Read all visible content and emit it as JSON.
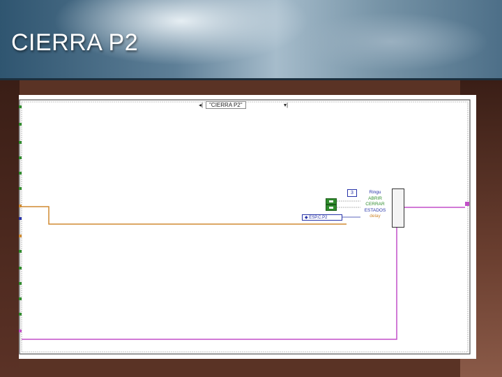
{
  "slide": {
    "title": "CIERRA P2"
  },
  "diagram": {
    "case_selector": "\"CIERRA P2\"",
    "case_left_arrow": "◂|",
    "case_right_arrow": "▾|",
    "constant_value": "3",
    "enum_constant": "ESP.C.P2",
    "bundle_fields": [
      "Ringu",
      "ABRIR",
      "CERRAR",
      "ESTADOS",
      "delay"
    ],
    "colors": {
      "orange_wire": "#d08a30",
      "pink_wire": "#c24fc8",
      "gray_wire": "#9a9a9a",
      "bool_green": "#2f8c2c",
      "enum_blue": "#2733a8"
    }
  }
}
